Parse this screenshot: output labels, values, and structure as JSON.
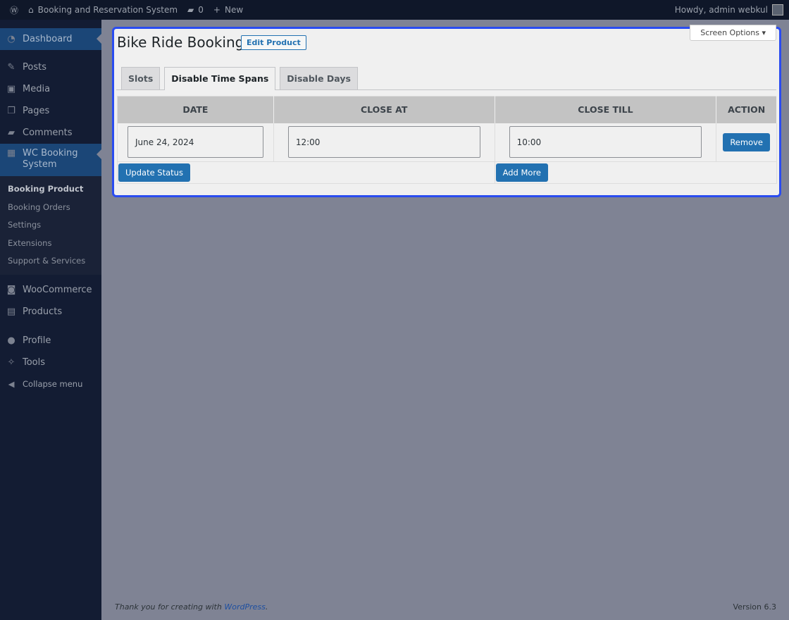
{
  "topbar": {
    "site": "Booking and Reservation System",
    "comments": "0",
    "new": "New",
    "howdy": "Howdy, admin webkul"
  },
  "sidebar": {
    "items": [
      {
        "label": "Dashboard",
        "icon": "dashboard-icon"
      },
      {
        "label": "Posts",
        "icon": "pin-icon"
      },
      {
        "label": "Media",
        "icon": "media-icon"
      },
      {
        "label": "Pages",
        "icon": "pages-icon"
      },
      {
        "label": "Comments",
        "icon": "comment-icon"
      },
      {
        "label": "WC Booking System",
        "icon": "calendar-icon"
      }
    ],
    "sub": [
      "Booking Product",
      "Booking Orders",
      "Settings",
      "Extensions",
      "Support & Services"
    ],
    "items2": [
      {
        "label": "WooCommerce"
      },
      {
        "label": "Products"
      },
      {
        "label": "Profile"
      },
      {
        "label": "Tools"
      },
      {
        "label": "Collapse menu"
      }
    ]
  },
  "panel": {
    "title": "Bike Ride Booking",
    "edit": "Edit Product",
    "screen_options": "Screen Options ▾",
    "tabs": [
      "Slots",
      "Disable Time Spans",
      "Disable Days"
    ],
    "headers": [
      "DATE",
      "CLOSE AT",
      "CLOSE TILL",
      "ACTION"
    ],
    "row": {
      "date": "June 24, 2024",
      "close_at": "12:00",
      "close_till": "10:00",
      "remove": "Remove"
    },
    "update": "Update Status",
    "add": "Add More"
  },
  "footer": {
    "thanks": "Thank you for creating with ",
    "wp": "WordPress",
    "dot": ".",
    "version": "Version 6.3"
  }
}
